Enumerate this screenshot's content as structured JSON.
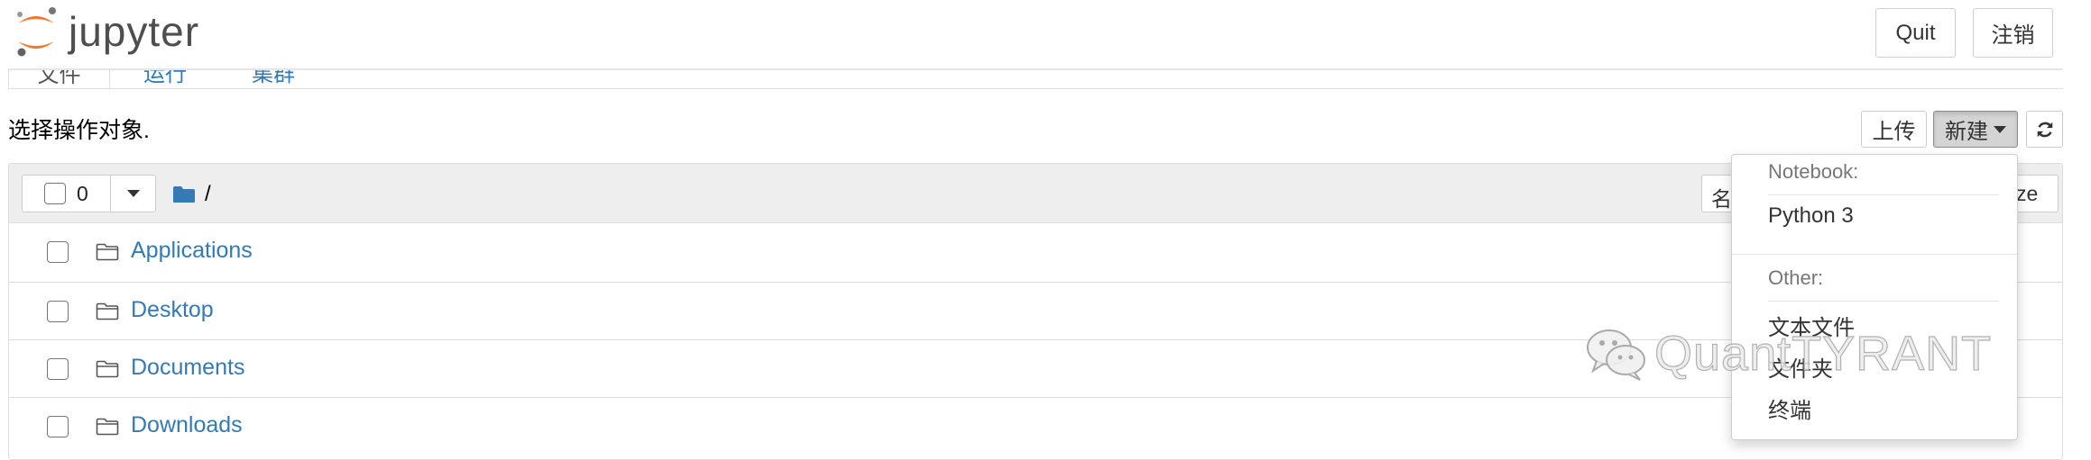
{
  "header": {
    "logo_text": "jupyter",
    "quit_label": "Quit",
    "logout_label": "注销"
  },
  "tabs": [
    {
      "label": "文件"
    },
    {
      "label": "运行"
    },
    {
      "label": "集群"
    }
  ],
  "toolbar": {
    "select_text": "选择操作对象.",
    "upload_label": "上传",
    "new_label": "新建",
    "refresh_icon": "refresh-icon"
  },
  "list": {
    "selected_count": "0",
    "path": "/",
    "name_sort_label": "名",
    "size_sort_label": "ze",
    "items": [
      {
        "name": "Applications",
        "icon": "folder-icon"
      },
      {
        "name": "Desktop",
        "icon": "folder-icon"
      },
      {
        "name": "Documents",
        "icon": "folder-icon"
      },
      {
        "name": "Downloads",
        "icon": "folder-icon"
      }
    ]
  },
  "new_menu": {
    "notebook_header": "Notebook:",
    "notebook_items": [
      "Python 3"
    ],
    "other_header": "Other:",
    "other_items": [
      "文本文件",
      "文件夹",
      "终端"
    ]
  },
  "watermark": {
    "text": "QuantTYRANT",
    "icon": "wechat-icon"
  },
  "colors": {
    "link": "#337ab7",
    "logo_orange": "#f37726",
    "header_bg": "#eeeeee"
  }
}
